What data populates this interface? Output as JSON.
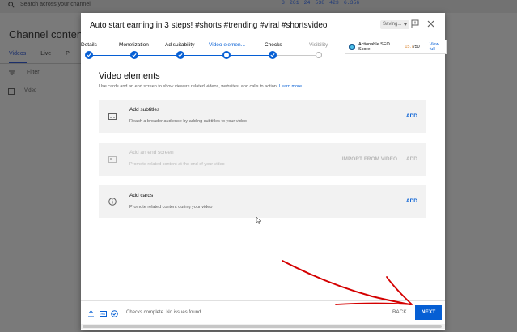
{
  "background": {
    "search_placeholder": "Search across your channel",
    "stats": [
      "3",
      "261",
      "24",
      "538",
      "423",
      "6.356"
    ],
    "page_title": "Channel content",
    "tabs": [
      "Videos",
      "Live",
      "P"
    ],
    "filter_label": "Filter",
    "table_header": "Video"
  },
  "dialog": {
    "title": "Auto start earning in 3 steps! #shorts #trending #viral #shortsvideo",
    "saving_label": "Saving...",
    "steps": [
      {
        "label": "Details",
        "state": "done"
      },
      {
        "label": "Monetization",
        "state": "done"
      },
      {
        "label": "Ad suitability",
        "state": "done"
      },
      {
        "label": "Video elemen...",
        "state": "current"
      },
      {
        "label": "Checks",
        "state": "done"
      },
      {
        "label": "Visibility",
        "state": "off"
      }
    ],
    "seo": {
      "label": "Actionable SEO Score:",
      "score": "15.7",
      "max": "/50",
      "view": "View full"
    },
    "section_title": "Video elements",
    "section_desc": "Use cards and an end screen to show viewers related videos, websites, and calls to action.",
    "learn_more": "Learn more",
    "cards": [
      {
        "title": "Add subtitles",
        "desc": "Reach a broader audience by adding subtitles to your video",
        "action": "ADD",
        "icon": "subtitles-icon"
      },
      {
        "title": "Add an end screen",
        "desc": "Promote related content at the end of your video",
        "secondary": "IMPORT FROM VIDEO",
        "action": "ADD",
        "icon": "end-screen-icon"
      },
      {
        "title": "Add cards",
        "desc": "Promote related content during your video",
        "action": "ADD",
        "icon": "info-icon"
      }
    ],
    "footer": {
      "status": "Checks complete. No issues found.",
      "back": "BACK",
      "next": "NEXT"
    }
  },
  "colors": {
    "accent": "#065fd4",
    "annotation": "#d40000",
    "overlay": "#7a7a7a"
  }
}
